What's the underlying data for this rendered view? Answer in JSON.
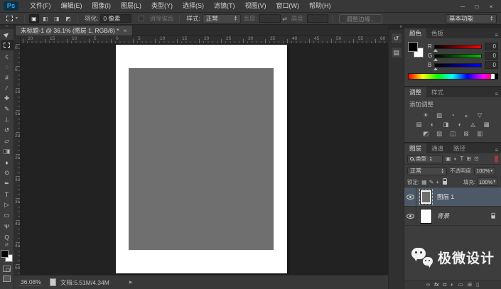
{
  "app": {
    "logo": "Ps"
  },
  "menubar": {
    "items": [
      "文件(F)",
      "编辑(E)",
      "图像(I)",
      "图层(L)",
      "类型(Y)",
      "选择(S)",
      "滤镜(T)",
      "视图(V)",
      "窗口(W)",
      "帮助(H)"
    ],
    "window_controls": {
      "minimize": "─",
      "maximize": "□",
      "close": "×"
    }
  },
  "options": {
    "selection_modes": [
      {
        "name": "new-selection-button",
        "glyph": "▣",
        "active": true
      },
      {
        "name": "add-to-selection-button",
        "glyph": "◧",
        "active": false
      },
      {
        "name": "subtract-from-selection-button",
        "glyph": "◨",
        "active": false
      },
      {
        "name": "intersect-selection-button",
        "glyph": "◩",
        "active": false
      }
    ],
    "feather_label": "羽化:",
    "feather_value": "0 像素",
    "antialias_label": "消除锯齿",
    "style_label": "样式:",
    "style_value": "正常",
    "width_label": "宽度:",
    "swap_icon": "⇄",
    "height_label": "高度:",
    "refine_edge_label": "调整边缘...",
    "workspace_label": "基本功能"
  },
  "document": {
    "tab_title": "未标题-1 @ 36.1% (图层 1, RGB/8) *",
    "tab_close": "×",
    "canvas_fill_color": "#6f6f6f",
    "page_color": "#ffffff"
  },
  "rulers": {
    "horizontal": [
      "20",
      "15",
      "10",
      "5",
      "0",
      "5",
      "10",
      "15",
      "20",
      "25",
      "30",
      "35",
      "40",
      "45",
      "50",
      "55",
      "60"
    ],
    "vertical": [
      "0",
      "5",
      "10",
      "15",
      "20",
      "25",
      "30",
      "35",
      "40",
      "45",
      "50"
    ]
  },
  "toolbar": {
    "tools": [
      {
        "name": "move-tool",
        "glyph": "▶",
        "kind": "move"
      },
      {
        "name": "rectangular-marquee-tool",
        "glyph": "",
        "kind": "marquee",
        "selected": true
      },
      {
        "name": "lasso-tool",
        "glyph": "ς"
      },
      {
        "name": "quick-selection-tool",
        "glyph": "◌"
      },
      {
        "name": "crop-tool",
        "glyph": "#"
      },
      {
        "name": "eyedropper-tool",
        "glyph": "∕"
      },
      {
        "name": "healing-brush-tool",
        "glyph": "✚"
      },
      {
        "name": "brush-tool",
        "glyph": "✎"
      },
      {
        "name": "clone-stamp-tool",
        "glyph": "⊥"
      },
      {
        "name": "history-brush-tool",
        "glyph": "↺"
      },
      {
        "name": "eraser-tool",
        "glyph": "▱"
      },
      {
        "name": "gradient-tool",
        "glyph": "",
        "kind": "gradient"
      },
      {
        "name": "blur-tool",
        "glyph": "♦"
      },
      {
        "name": "dodge-tool",
        "glyph": "⊙"
      },
      {
        "name": "pen-tool",
        "glyph": "✒"
      },
      {
        "name": "type-tool",
        "glyph": "T"
      },
      {
        "name": "path-selection-tool",
        "glyph": "▷"
      },
      {
        "name": "rectangle-tool",
        "glyph": "▭"
      },
      {
        "name": "hand-tool",
        "glyph": "Ψ"
      },
      {
        "name": "zoom-tool",
        "glyph": "Q"
      }
    ]
  },
  "status": {
    "zoom": "36.08%",
    "doc_info": "文档:5.51M/4.34M",
    "expand_arrow": "▶"
  },
  "panels": {
    "dock_strip": [
      {
        "name": "history-panel-button",
        "glyph": "↺"
      },
      {
        "name": "properties-panel-button",
        "glyph": "▤"
      }
    ],
    "color": {
      "tabs": [
        "颜色",
        "色板"
      ],
      "channels": [
        {
          "label": "R",
          "value": "0",
          "from": "#000000",
          "to": "#ff0000"
        },
        {
          "label": "G",
          "value": "0",
          "from": "#000000",
          "to": "#00c000"
        },
        {
          "label": "B",
          "value": "0",
          "from": "#000000",
          "to": "#0000ff"
        }
      ]
    },
    "adjustments": {
      "tabs": [
        "调整",
        "样式"
      ],
      "add_label": "添加调整",
      "rows": [
        [
          {
            "name": "brightness-contrast-adjustment-icon",
            "glyph": "☀"
          },
          {
            "name": "levels-adjustment-icon",
            "glyph": "▧"
          },
          {
            "name": "curves-adjustment-icon",
            "glyph": "◔"
          },
          {
            "name": "exposure-adjustment-icon",
            "glyph": "◒"
          },
          {
            "name": "vibrance-adjustment-icon",
            "glyph": "▽"
          }
        ],
        [
          {
            "name": "hue-saturation-adjustment-icon",
            "glyph": "▤"
          },
          {
            "name": "color-balance-adjustment-icon",
            "glyph": "◐"
          },
          {
            "name": "black-white-adjustment-icon",
            "glyph": "◨"
          },
          {
            "name": "photo-filter-adjustment-icon",
            "glyph": "◖"
          },
          {
            "name": "channel-mixer-adjustment-icon",
            "glyph": "◬"
          },
          {
            "name": "color-lookup-adjustment-icon",
            "glyph": "▦"
          }
        ],
        [
          {
            "name": "invert-adjustment-icon",
            "glyph": "◩"
          },
          {
            "name": "posterize-adjustment-icon",
            "glyph": "▨"
          },
          {
            "name": "threshold-adjustment-icon",
            "glyph": "◫"
          },
          {
            "name": "selective-color-adjustment-icon",
            "glyph": "⊠"
          },
          {
            "name": "gradient-map-adjustment-icon",
            "glyph": "▥"
          }
        ]
      ]
    },
    "layers": {
      "tabs": [
        "图层",
        "通道",
        "路径"
      ],
      "filter_label": "类型",
      "filter_icons": [
        {
          "name": "pixel-layer-filter-icon",
          "glyph": "▣"
        },
        {
          "name": "adjustment-layer-filter-icon",
          "glyph": "◐"
        },
        {
          "name": "type-layer-filter-icon",
          "glyph": "T"
        },
        {
          "name": "shape-layer-filter-icon",
          "glyph": "⊞"
        },
        {
          "name": "smart-object-filter-icon",
          "glyph": "⊡"
        }
      ],
      "filter_switch_color": "#9e3b3b",
      "blend_mode": "正常",
      "opacity_label": "不透明度:",
      "opacity_value": "100%",
      "lock_label": "锁定:",
      "lock_icons": [
        {
          "name": "lock-transparency-icon",
          "glyph": "▦"
        },
        {
          "name": "lock-paint-icon",
          "glyph": "✎"
        },
        {
          "name": "lock-position-icon",
          "glyph": "+"
        },
        {
          "name": "lock-all-icon",
          "glyph": "",
          "kind": "lock"
        }
      ],
      "fill_label": "填充:",
      "fill_value": "100%",
      "rows": [
        {
          "label": "图层 1",
          "selected": true,
          "thumb": "gray",
          "locked": false,
          "italic": false
        },
        {
          "label": "背景",
          "selected": false,
          "thumb": "white",
          "locked": true,
          "italic": true
        }
      ],
      "selected_row_color": "#4d5966",
      "action_icons": [
        {
          "name": "link-layers-icon",
          "glyph": "∞"
        },
        {
          "name": "layer-style-icon",
          "glyph": "fx"
        },
        {
          "name": "add-layer-mask-icon",
          "glyph": "◘"
        },
        {
          "name": "new-adjustment-layer-icon",
          "glyph": "◐"
        },
        {
          "name": "new-group-icon",
          "glyph": "▭"
        },
        {
          "name": "new-layer-icon",
          "glyph": "⊞"
        },
        {
          "name": "delete-layer-icon",
          "glyph": "▯"
        }
      ]
    }
  },
  "watermark": {
    "text": "极微设计"
  }
}
